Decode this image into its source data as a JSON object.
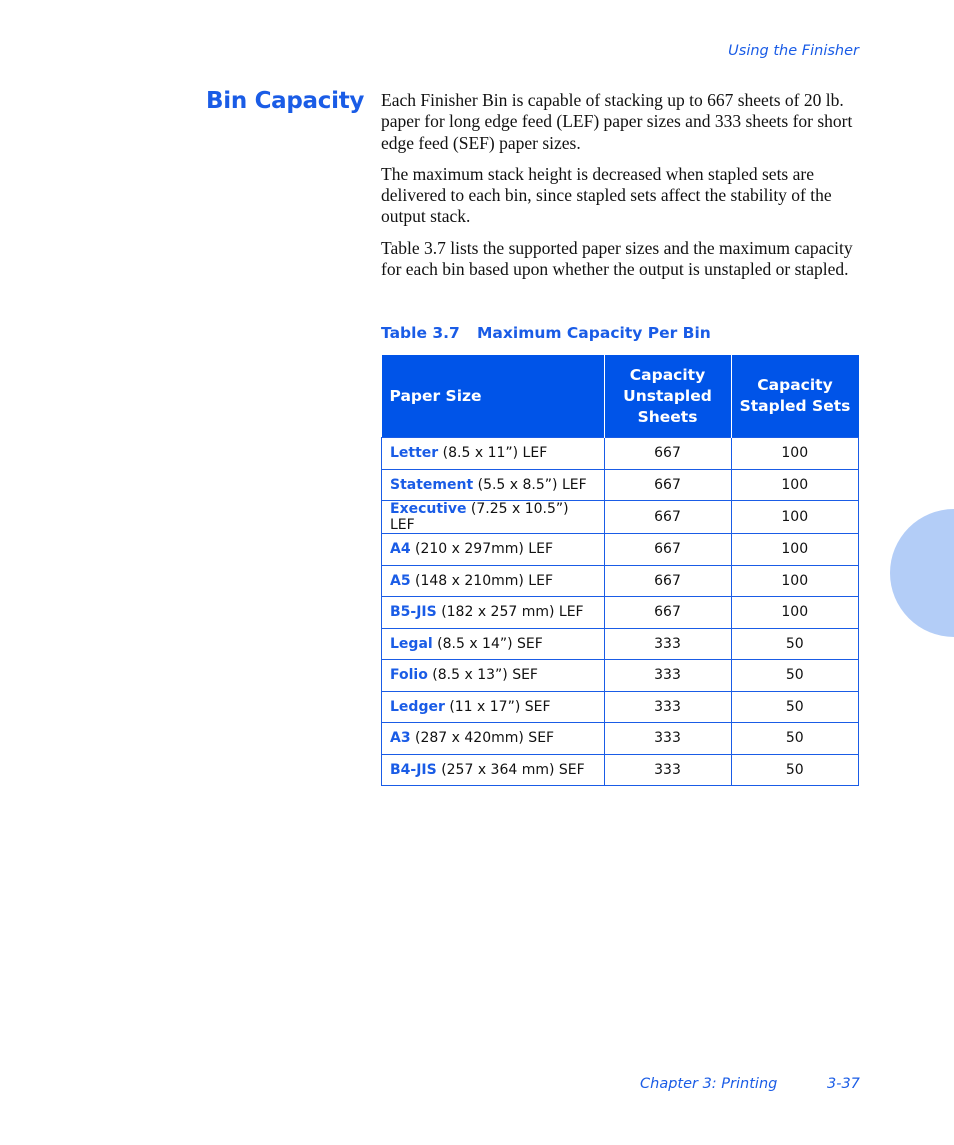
{
  "header": {
    "running_title": "Using the Finisher"
  },
  "section": {
    "title": "Bin Capacity",
    "paragraphs": [
      "Each Finisher Bin is capable of stacking up to 667 sheets of 20 lb. paper for long edge feed (LEF) paper sizes and 333 sheets for short edge feed (SEF) paper sizes.",
      "The maximum stack height is decreased when stapled sets are delivered to each bin, since stapled sets affect the stability of the output stack.",
      "Table 3.7 lists the supported paper sizes and the maximum capacity for each bin based upon whether the output is unstapled or stapled."
    ]
  },
  "table": {
    "caption_number": "Table 3.7",
    "caption_title": "Maximum Capacity Per Bin",
    "headers": [
      "Paper Size",
      "Capacity Unstapled Sheets",
      "Capacity Stapled Sets"
    ],
    "rows": [
      {
        "name": "Letter",
        "dims": "(8.5 x 11”) LEF",
        "unstapled": "667",
        "stapled": "100"
      },
      {
        "name": "Statement",
        "dims": "(5.5 x 8.5”) LEF",
        "unstapled": "667",
        "stapled": "100"
      },
      {
        "name": "Executive",
        "dims": "(7.25 x 10.5”) LEF",
        "unstapled": "667",
        "stapled": "100"
      },
      {
        "name": "A4",
        "dims": "(210 x 297mm) LEF",
        "unstapled": "667",
        "stapled": "100"
      },
      {
        "name": "A5",
        "dims": "(148 x 210mm) LEF",
        "unstapled": "667",
        "stapled": "100"
      },
      {
        "name": "B5-JIS",
        "dims": "(182 x 257 mm) LEF",
        "unstapled": "667",
        "stapled": "100"
      },
      {
        "name": "Legal",
        "dims": "(8.5 x 14”) SEF",
        "unstapled": "333",
        "stapled": "50"
      },
      {
        "name": "Folio",
        "dims": "(8.5 x 13”) SEF",
        "unstapled": "333",
        "stapled": "50"
      },
      {
        "name": "Ledger",
        "dims": "(11 x 17”) SEF",
        "unstapled": "333",
        "stapled": "50"
      },
      {
        "name": "A3",
        "dims": "(287 x 420mm) SEF",
        "unstapled": "333",
        "stapled": "50"
      },
      {
        "name": "B4-JIS",
        "dims": "(257 x 364 mm) SEF",
        "unstapled": "333",
        "stapled": "50"
      }
    ]
  },
  "footer": {
    "chapter": "Chapter 3: Printing",
    "page": "3-37"
  },
  "colors": {
    "accent": "#1a5ce6",
    "header_fill": "#0054e8",
    "tab_marker": "#b3cdf7"
  }
}
